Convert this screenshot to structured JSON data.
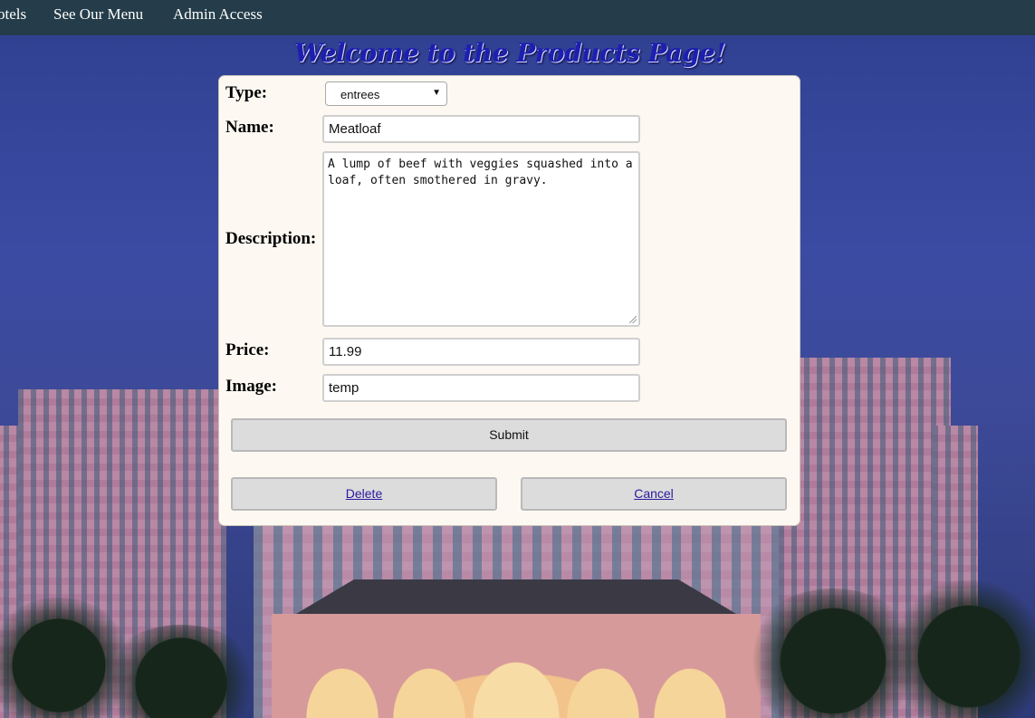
{
  "nav": {
    "items": [
      {
        "label": "otels"
      },
      {
        "label": "See Our Menu"
      },
      {
        "label": "Admin Access"
      }
    ]
  },
  "heading": "Welcome to the Products Page!",
  "form": {
    "type": {
      "label": "Type:",
      "selected": "entrees"
    },
    "name": {
      "label": "Name:",
      "value": "Meatloaf"
    },
    "description": {
      "label": "Description:",
      "value": "A lump of beef with veggies squashed into a loaf, often smothered in gravy."
    },
    "price": {
      "label": "Price:",
      "value": "11.99"
    },
    "image": {
      "label": "Image:",
      "value": "temp"
    },
    "submit_label": "Submit",
    "delete_label": "Delete",
    "cancel_label": "Cancel"
  },
  "colors": {
    "nav_bg": "#253d4a",
    "heading": "#1d1fb0",
    "card_bg": "#fdf9f2",
    "button_bg": "#dcdcdc",
    "link": "#2a1a9e"
  }
}
